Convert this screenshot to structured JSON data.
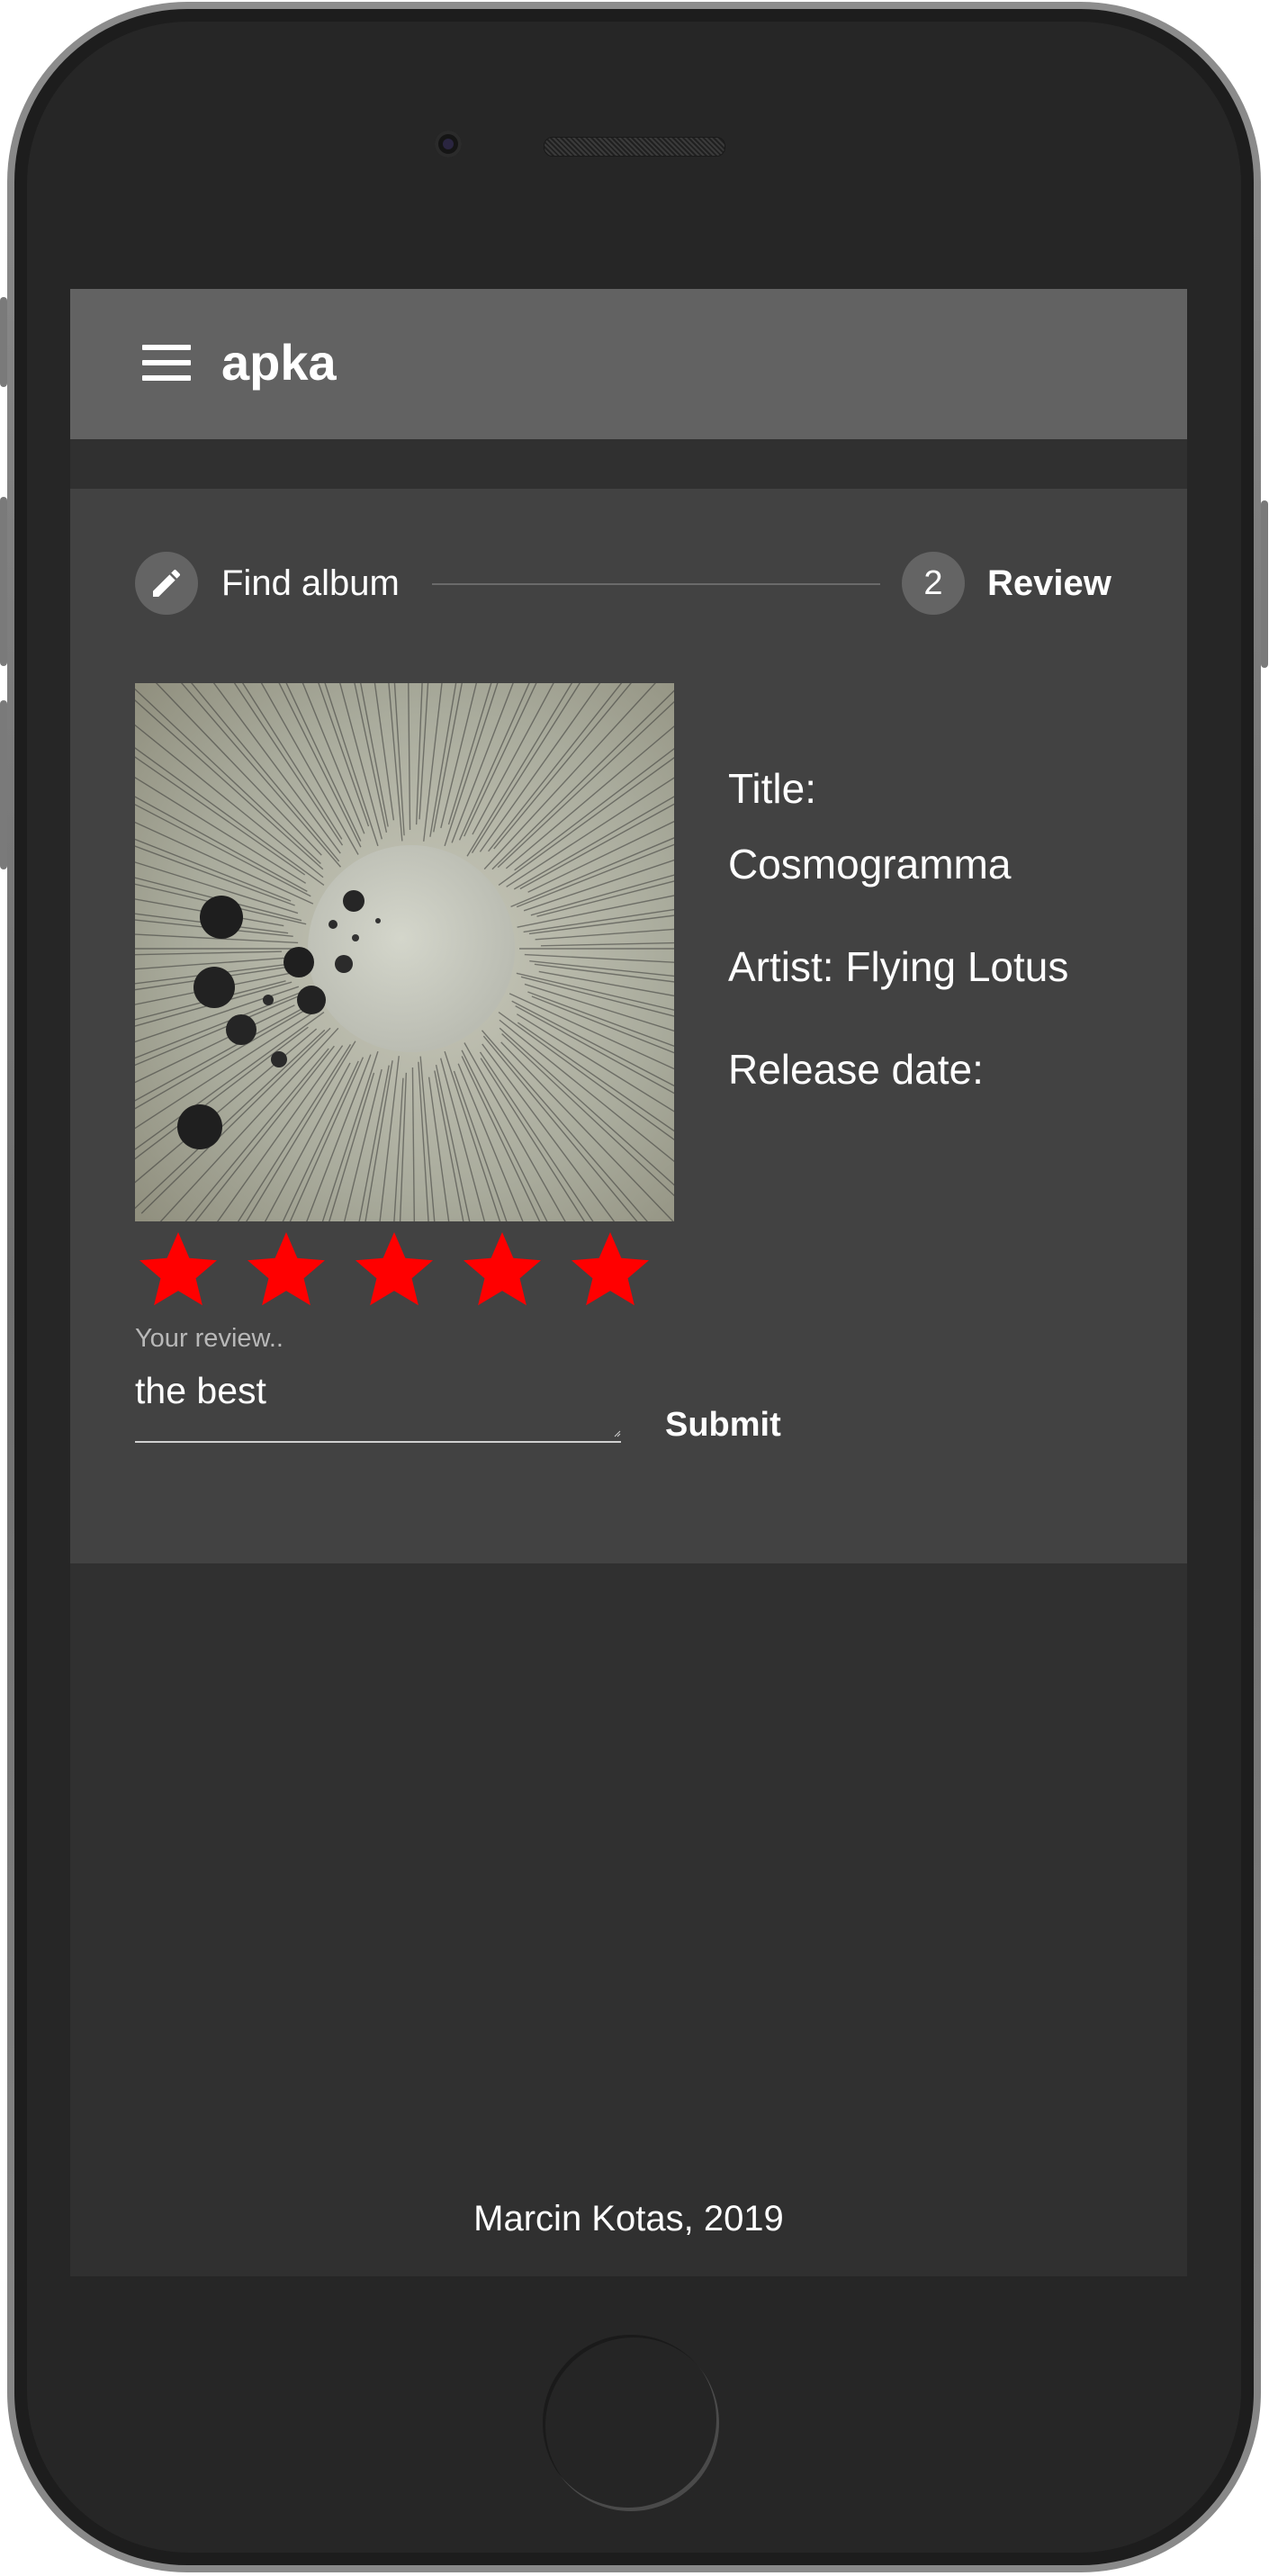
{
  "app_bar": {
    "title": "apka",
    "menu_icon": "menu-icon"
  },
  "stepper": {
    "step1": {
      "label": "Find album",
      "icon": "pencil-icon"
    },
    "step2": {
      "number": "2",
      "label": "Review"
    }
  },
  "album": {
    "title_line": "Title:",
    "title_value": "Cosmogramma",
    "artist_line": "Artist: Flying Lotus",
    "release_line": "Release date:",
    "cover": "album-cover-image"
  },
  "rating": {
    "value": 5,
    "max": 5,
    "color": "#ff0000"
  },
  "review": {
    "placeholder": "Your review..",
    "value": "the best"
  },
  "submit": {
    "label": "Submit"
  },
  "footer": {
    "text": "Marcin Kotas, 2019"
  },
  "colors": {
    "app_bar": "#626262",
    "card": "#424242",
    "screen": "#303030",
    "star": "#ff0000"
  }
}
